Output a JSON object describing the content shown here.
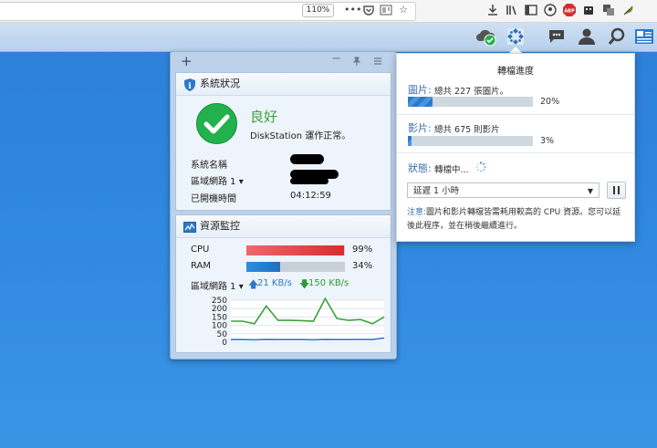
{
  "browser": {
    "zoom": "110%",
    "icons": [
      "more-icon",
      "pocket-icon",
      "reader-icon",
      "bookmark-star-icon",
      "download-icon",
      "library-icon",
      "sidebar-icon",
      "account-icon",
      "adblock-icon",
      "extension-icon",
      "translate-icon",
      "extension-feather-icon"
    ],
    "adblock_label": "ABP"
  },
  "taskbar": {
    "icons": [
      "cloud-sync-icon",
      "convert-progress-icon",
      "chat-icon",
      "user-icon",
      "search-icon",
      "widgets-icon"
    ]
  },
  "widgets": {
    "toolbar": {
      "add": "+",
      "minimize": "−",
      "pin": "pin",
      "menu": "menu"
    },
    "system_health": {
      "title": "系統狀況",
      "status": "良好",
      "status_detail": "DiskStation 運作正常。",
      "rows": [
        {
          "label": "系統名稱",
          "value": ""
        },
        {
          "label": "區域網路 1 ▾",
          "value": ""
        },
        {
          "label": "已開機時間",
          "value": "04:12:59"
        }
      ]
    },
    "resource_monitor": {
      "title": "資源監控",
      "cpu_label": "CPU",
      "cpu_percent": 99,
      "cpu_text": "99%",
      "ram_label": "RAM",
      "ram_percent": 34,
      "ram_text": "34%",
      "lan_label": "區域網路 1 ▾",
      "upload": "21 KB/s",
      "download": "150 KB/s",
      "chart_data": {
        "type": "line",
        "yticks": [
          250,
          200,
          150,
          100,
          50,
          0
        ],
        "ylim": [
          0,
          250
        ],
        "series": [
          {
            "color": "#3aa33a",
            "values": [
              125,
              125,
              110,
              215,
              130,
              130,
              128,
              125,
              260,
              140,
              130,
              135,
              110,
              150
            ]
          },
          {
            "color": "#2c7bd6",
            "values": [
              15,
              15,
              14,
              16,
              15,
              15,
              15,
              14,
              16,
              15,
              15,
              16,
              15,
              25
            ]
          }
        ]
      }
    }
  },
  "conversion": {
    "title": "轉檔進度",
    "photos_label": "圖片:",
    "photos_text": "總共 227 張圖片。",
    "photos_percent": 20,
    "photos_pct_text": "20%",
    "videos_label": "影片:",
    "videos_text": "總共 675 則影片",
    "videos_percent": 3,
    "videos_pct_text": "3%",
    "status_label": "狀態:",
    "status_text": "轉檔中...",
    "delay_value": "延遲 1 小時",
    "note_label": "注意:",
    "note_text": "圖片和影片轉檔皆需耗用較高的 CPU 資源。您可以延後此程序，並在稍後繼續進行。"
  },
  "colors": {
    "accent": "#2e86de",
    "ok_green": "#22b14c",
    "cpu_red": "#e53935",
    "ram_blue": "#2c7bd6"
  }
}
